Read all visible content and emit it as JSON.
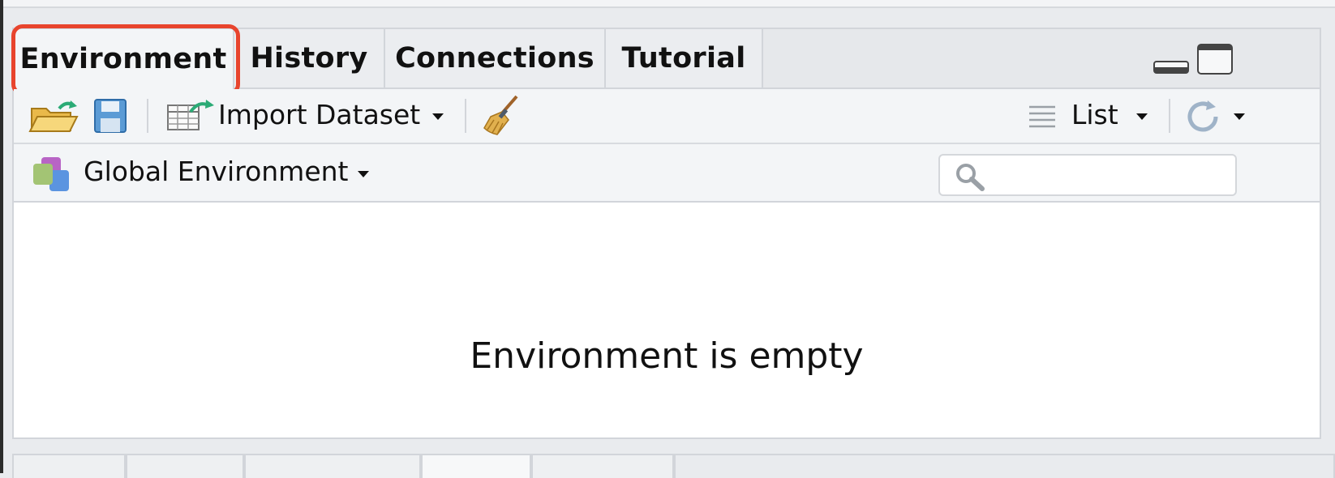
{
  "tabs": [
    {
      "label": "Environment",
      "active": true
    },
    {
      "label": "History",
      "active": false
    },
    {
      "label": "Connections",
      "active": false
    },
    {
      "label": "Tutorial",
      "active": false
    }
  ],
  "toolbar": {
    "open_icon": "folder-open-icon",
    "save_icon": "floppy-disk-icon",
    "import_label": "Import Dataset",
    "broom_icon": "broom-icon",
    "view_label": "List",
    "refresh_icon": "refresh-icon"
  },
  "environment": {
    "selector_label": "Global Environment",
    "search_placeholder": ""
  },
  "content": {
    "empty_message": "Environment is empty"
  },
  "colors": {
    "highlight": "#e8442d",
    "accent_green": "#2bab76"
  }
}
